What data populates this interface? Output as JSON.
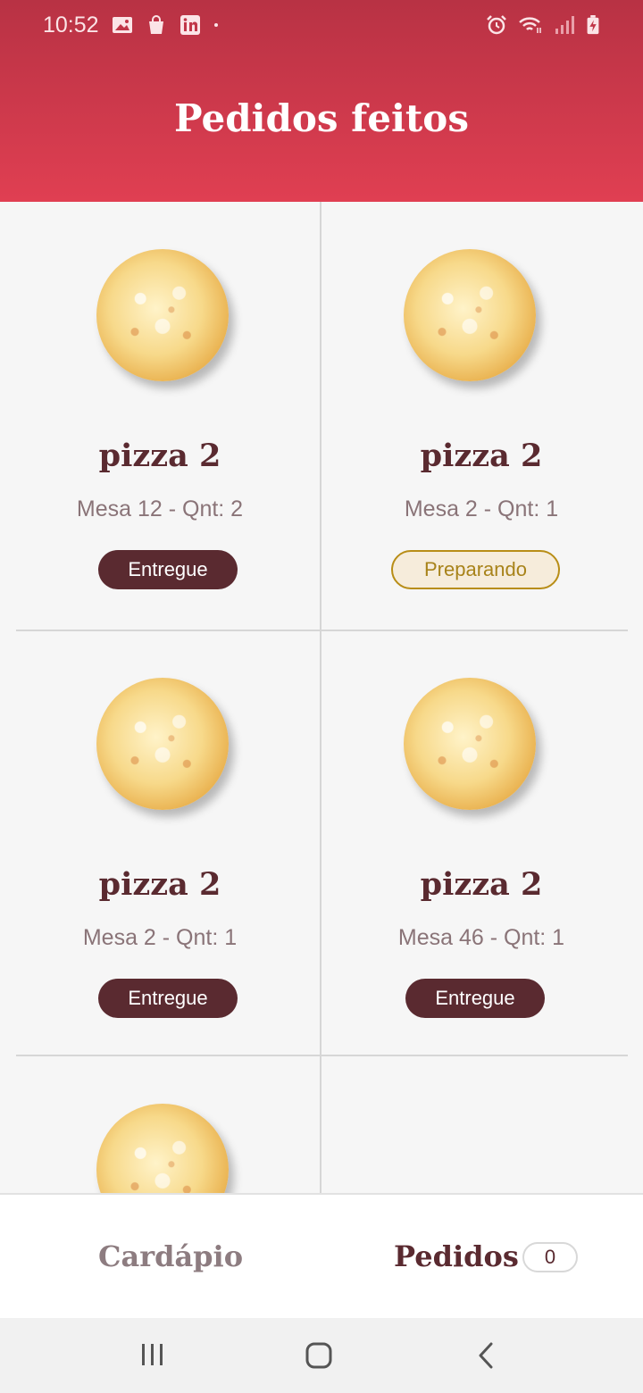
{
  "status_bar": {
    "time": "10:52",
    "left_icons": [
      "image-icon",
      "shopping-bag-icon",
      "linkedin-icon",
      "dot-icon"
    ],
    "right_icons": [
      "alarm-icon",
      "wifi-icon",
      "signal-icon",
      "battery-charging-icon"
    ]
  },
  "header": {
    "title": "Pedidos feitos"
  },
  "orders": [
    {
      "name": "pizza 2",
      "details": "Mesa 12 - Qnt: 2",
      "status": "Entregue",
      "status_type": "delivered"
    },
    {
      "name": "pizza 2",
      "details": "Mesa 2 - Qnt: 1",
      "status": "Preparando",
      "status_type": "preparing"
    },
    {
      "name": "pizza 2",
      "details": "Mesa 2 - Qnt: 1",
      "status": "Entregue",
      "status_type": "delivered"
    },
    {
      "name": "pizza 2",
      "details": "Mesa 46 - Qnt: 1",
      "status": "Entregue",
      "status_type": "delivered"
    },
    {
      "name": "",
      "details": "",
      "status": "",
      "status_type": ""
    }
  ],
  "bottom_nav": {
    "menu_label": "Cardápio",
    "orders_label": "Pedidos",
    "orders_count": "0"
  },
  "system_nav": [
    "recents-icon",
    "home-icon",
    "back-icon"
  ],
  "colors": {
    "header_top": "#b83244",
    "header_bottom": "#e03f52",
    "primary_dark": "#5a2a30",
    "preparing_border": "#b88d16"
  }
}
